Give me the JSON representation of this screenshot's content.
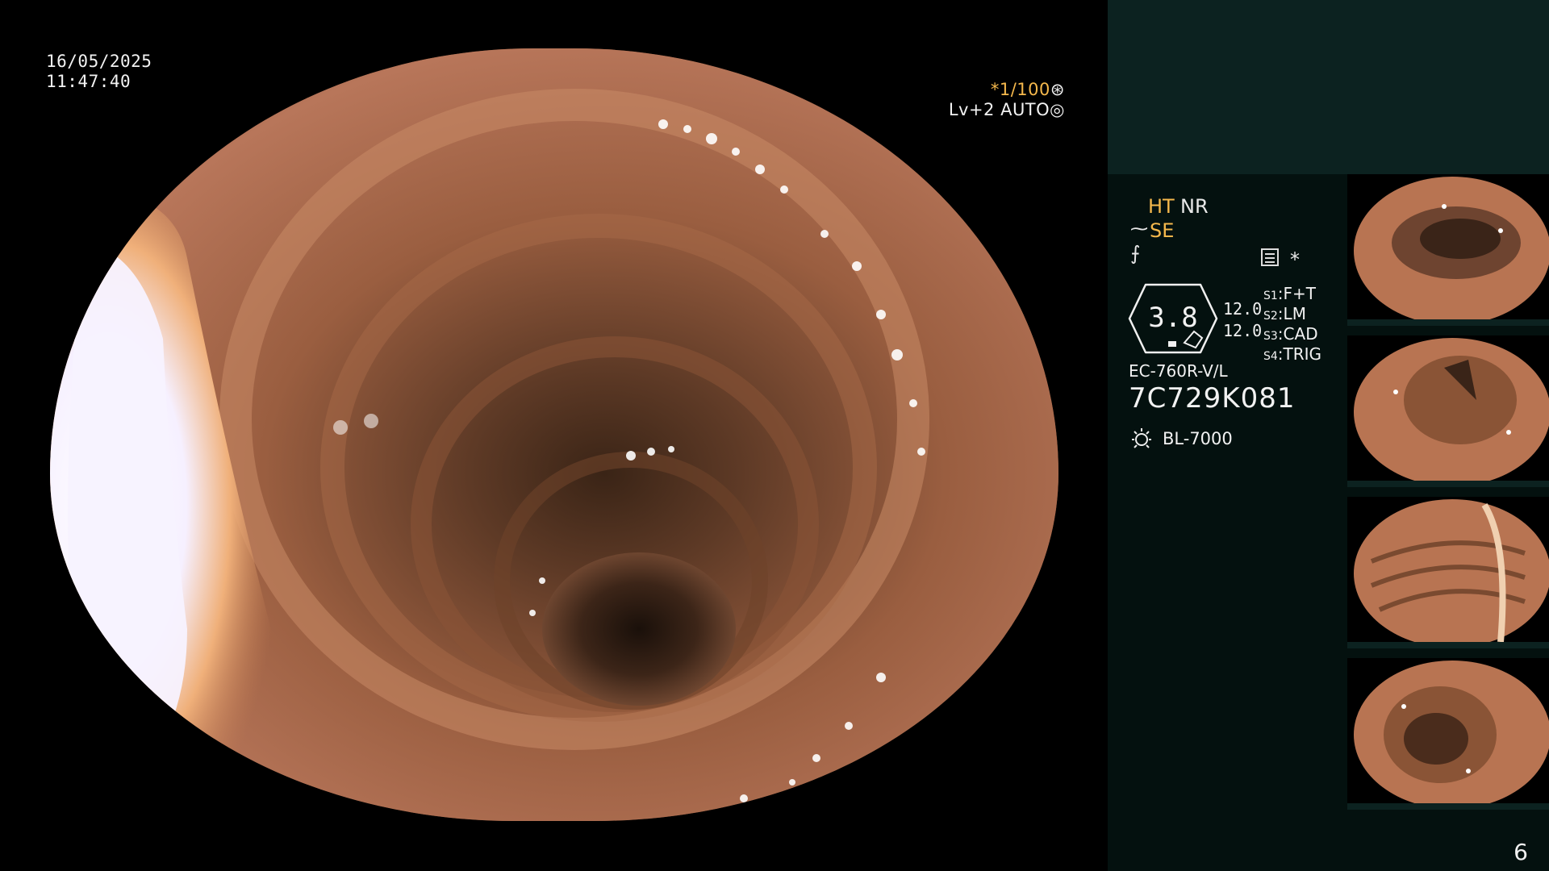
{
  "overlay": {
    "date": "16/05/2025",
    "time": "11:47:40",
    "shutter": "*1/100",
    "shutter_icon": "aperture-icon",
    "level": "Lv+2 AUTO",
    "level_icon": "target-icon"
  },
  "status": {
    "ht": "HT",
    "nr": "NR",
    "se_icon": "⁓",
    "se": "SE",
    "f_icon": "⨍",
    "star": "*",
    "zoom_value": "3.8",
    "level_top": "12.0",
    "level_bottom": "12.0",
    "slots": [
      {
        "key": "S1",
        "value": "F+T"
      },
      {
        "key": "S2",
        "value": "LM"
      },
      {
        "key": "S3",
        "value": "CAD"
      },
      {
        "key": "S4",
        "value": "TRIG"
      }
    ],
    "scope_model": "EC-760R-V/L",
    "scope_serial": "7C729K081",
    "light_source": "BL-7000"
  },
  "colors": {
    "panel_top": "#0c2220",
    "panel": "#04110f",
    "amber": "#f5b84c"
  },
  "page_number": "6"
}
